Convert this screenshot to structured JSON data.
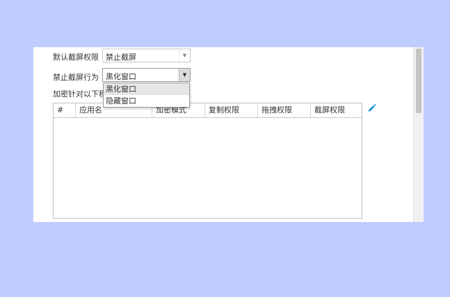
{
  "settings": {
    "default_permission_label": "默认截屏权限",
    "default_permission_value": "禁止截屏",
    "behavior_label": "禁止截屏行为",
    "behavior_value": "黑化窗口",
    "encrypt_label": "加密针对以下程"
  },
  "dropdown": {
    "options": [
      {
        "label": "黑化窗口",
        "selected": true
      },
      {
        "label": "隐藏窗口",
        "selected": false
      }
    ]
  },
  "table": {
    "columns": [
      "#",
      "应用名",
      "加密模式",
      "复制权限",
      "拖拽权限",
      "截屏权限"
    ],
    "rows": []
  },
  "icons": {
    "edit": "pencil-icon",
    "select_arrow": "chevron-down-icon"
  },
  "colors": {
    "background": "#c0ccff",
    "accent": "#1e90e0",
    "selected_option": "#e6e6e6"
  }
}
